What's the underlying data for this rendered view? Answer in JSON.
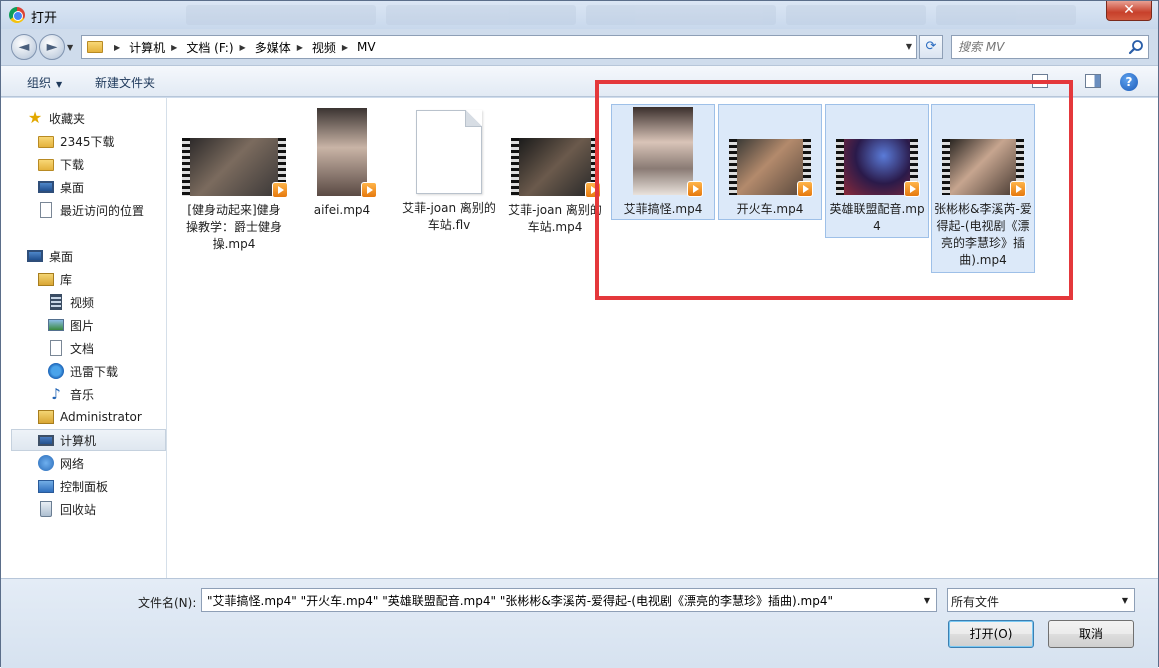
{
  "window": {
    "title": "打开",
    "close_glyph": "✕"
  },
  "nav": {
    "back_glyph": "◄",
    "forward_glyph": "►",
    "breadcrumb": [
      "计算机",
      "文档 (F:)",
      "多媒体",
      "视频",
      "MV"
    ],
    "refresh_glyph": "⟳",
    "search_placeholder": "搜索 MV"
  },
  "toolbar": {
    "organize": "组织",
    "new_folder": "新建文件夹",
    "help": "?"
  },
  "sidebar": {
    "favorites": [
      {
        "label": "收藏夹",
        "icon": "star-icon"
      },
      {
        "label": "2345下载",
        "icon": "folder-icon"
      },
      {
        "label": "下载",
        "icon": "folder-icon"
      },
      {
        "label": "桌面",
        "icon": "desktop-icon"
      },
      {
        "label": "最近访问的位置",
        "icon": "recent-places-icon"
      }
    ],
    "desktop": {
      "label": "桌面",
      "icon": "desktop-icon"
    },
    "libraries": [
      {
        "label": "库",
        "icon": "library-icon"
      },
      {
        "label": "视频",
        "icon": "video-library-icon"
      },
      {
        "label": "图片",
        "icon": "pictures-library-icon"
      },
      {
        "label": "文档",
        "icon": "documents-library-icon"
      },
      {
        "label": "迅雷下载",
        "icon": "download-icon"
      },
      {
        "label": "音乐",
        "icon": "music-icon"
      }
    ],
    "others": [
      {
        "label": "Administrator",
        "icon": "user-folder-icon"
      },
      {
        "label": "计算机",
        "icon": "computer-icon",
        "selected": true
      },
      {
        "label": "网络",
        "icon": "network-icon"
      },
      {
        "label": "控制面板",
        "icon": "control-panel-icon"
      },
      {
        "label": "回收站",
        "icon": "recycle-bin-icon"
      }
    ]
  },
  "files": [
    {
      "name": "[健身动起来]健身操教学：爵士健身操.mp4",
      "type": "video",
      "selected": false
    },
    {
      "name": "aifei.mp4",
      "type": "video",
      "selected": false
    },
    {
      "name": "艾菲-joan 离别的车站.flv",
      "type": "blank",
      "selected": false
    },
    {
      "name": "艾菲-joan 离别的车站.mp4",
      "type": "video",
      "selected": false
    },
    {
      "name": "艾菲搞怪.mp4",
      "type": "video",
      "selected": true
    },
    {
      "name": "开火车.mp4",
      "type": "video",
      "selected": true
    },
    {
      "name": "英雄联盟配音.mp4",
      "type": "video",
      "selected": true
    },
    {
      "name": "张彬彬&李溪芮-爱得起-(电视剧《漂亮的李慧珍》插曲).mp4",
      "type": "video",
      "selected": true
    }
  ],
  "bottom": {
    "filename_label": "文件名(N):",
    "filename_value": "\"艾菲搞怪.mp4\" \"开火车.mp4\" \"英雄联盟配音.mp4\" \"张彬彬&李溪芮-爱得起-(电视剧《漂亮的李慧珍》插曲).mp4\"",
    "file_type": "所有文件",
    "open_button": "打开(O)",
    "cancel_button": "取消"
  },
  "colors": {
    "highlight": "#e4383b",
    "selection": "#dce9f9",
    "accent": "#1e395b"
  }
}
